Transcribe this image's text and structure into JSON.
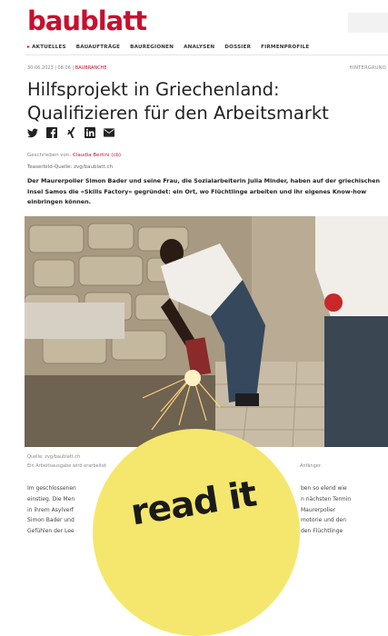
{
  "site": {
    "logo": "baublatt"
  },
  "nav": {
    "items": [
      "AKTUELLES",
      "BAUAUFTRÄGE",
      "BAUREGIONEN",
      "ANALYSEN",
      "DOSSIER",
      "FIRMENPROFILE"
    ]
  },
  "article": {
    "meta_date": "30.06.2023 | 08:06 |",
    "meta_category": "BAUBRANCHE",
    "tag": "HINTERGRUND",
    "title": "Hilfsprojekt in Griechenland: Qualifizieren für den Arbeitsmarkt",
    "byline_prefix": "Geschrieben von:",
    "byline_author": "Claudia Bertini (cb)",
    "image_credit": "Teaserbild-Quelle: zvg/baublatt.ch",
    "lead": "Der Maurerpolier Simon Bader und seine Frau, die Sozialarbeiterin Julia Minder, haben auf der griechischen Insel Samos die «Skills Factory» gegründet: ein Ort, wo Flüchtlinge arbeiten und ihr eigenes Know-how einbringen können.",
    "photo_caption_source": "Quelle: zvg/baublatt.ch",
    "photo_caption_text": "Ein Arbeitsausgabe wird erarbeitet",
    "photo_caption_tail": "Anfänger.",
    "body_left": [
      "Im geschlossenen",
      "einstieg. Die Men",
      "in ihrem Asylverf",
      "Simon Bader und",
      "Gefühlen der Lee"
    ],
    "body_right": [
      "ben so elend wie",
      "n nächsten Termin",
      "Maurerpolier",
      "motorie und den",
      "den Flüchtlinge"
    ]
  },
  "overlay": {
    "label": "read it"
  },
  "colors": {
    "brand": "#c8102e",
    "overlay": "#f5e76d"
  },
  "share_icons": [
    "twitter-icon",
    "facebook-icon",
    "xing-icon",
    "linkedin-icon",
    "mail-icon"
  ]
}
